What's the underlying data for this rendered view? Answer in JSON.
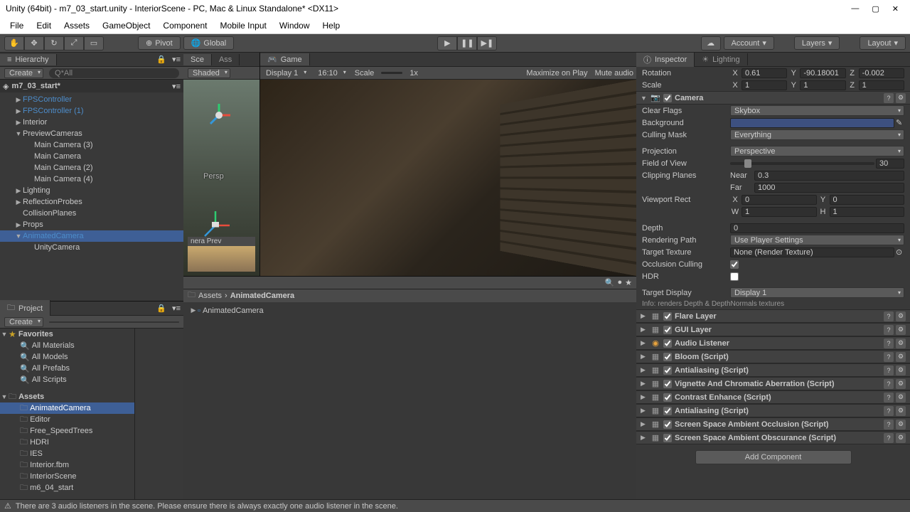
{
  "window": {
    "title": "Unity (64bit) - m7_03_start.unity - InteriorScene - PC, Mac & Linux Standalone* <DX11>"
  },
  "menu": [
    "File",
    "Edit",
    "Assets",
    "GameObject",
    "Component",
    "Mobile Input",
    "Window",
    "Help"
  ],
  "toolbar": {
    "pivot": "Pivot",
    "global": "Global",
    "account": "Account",
    "layers": "Layers",
    "layout": "Layout"
  },
  "hierarchy": {
    "title": "Hierarchy",
    "create": "Create",
    "search_ph": "Q*All",
    "scene": "m7_03_start*",
    "items": [
      {
        "label": "FPSController",
        "indent": 1,
        "prefab": true,
        "arrow": "▶"
      },
      {
        "label": "FPSController (1)",
        "indent": 1,
        "prefab": true,
        "arrow": "▶"
      },
      {
        "label": "Interior",
        "indent": 1,
        "arrow": "▶"
      },
      {
        "label": "PreviewCameras",
        "indent": 1,
        "arrow": "▼"
      },
      {
        "label": "Main Camera (3)",
        "indent": 2,
        "arrow": ""
      },
      {
        "label": "Main Camera",
        "indent": 2,
        "arrow": ""
      },
      {
        "label": "Main Camera (2)",
        "indent": 2,
        "arrow": ""
      },
      {
        "label": "Main Camera (4)",
        "indent": 2,
        "arrow": ""
      },
      {
        "label": "Lighting",
        "indent": 1,
        "arrow": "▶"
      },
      {
        "label": "ReflectionProbes",
        "indent": 1,
        "arrow": "▶"
      },
      {
        "label": "CollisionPlanes",
        "indent": 1,
        "arrow": ""
      },
      {
        "label": "Props",
        "indent": 1,
        "arrow": "▶"
      },
      {
        "label": "AnimatedCamera",
        "indent": 1,
        "prefab": true,
        "arrow": "▼",
        "sel": true
      },
      {
        "label": "UnityCamera",
        "indent": 2,
        "arrow": ""
      }
    ]
  },
  "scene": {
    "tab_scene": "Sce",
    "tab_asset": "Ass",
    "shaded": "Shaded",
    "persp": "Persp",
    "cam_prev": "nera Prev"
  },
  "game": {
    "title": "Game",
    "display": "Display 1",
    "aspect": "16:10",
    "scale": "Scale",
    "scale_val": "1x",
    "max": "Maximize on Play",
    "mute": "Mute audio"
  },
  "inspector": {
    "title": "Inspector",
    "lighting": "Lighting",
    "rotation": "Rotation",
    "rot_x": "0.61",
    "rot_y": "-90.18001",
    "rot_z": "-0.002",
    "scale": "Scale",
    "scl_x": "1",
    "scl_y": "1",
    "scl_z": "1",
    "camera": "Camera",
    "clear_flags": "Clear Flags",
    "clear_flags_v": "Skybox",
    "background": "Background",
    "culling": "Culling Mask",
    "culling_v": "Everything",
    "projection": "Projection",
    "projection_v": "Perspective",
    "fov": "Field of View",
    "fov_v": "30",
    "clip": "Clipping Planes",
    "near": "Near",
    "near_v": "0.3",
    "far": "Far",
    "far_v": "1000",
    "viewport": "Viewport Rect",
    "vr_x": "0",
    "vr_y": "0",
    "vr_w": "1",
    "vr_h": "1",
    "depth": "Depth",
    "depth_v": "0",
    "rendering": "Rendering Path",
    "rendering_v": "Use Player Settings",
    "target_tex": "Target Texture",
    "target_tex_v": "None (Render Texture)",
    "occlusion": "Occlusion Culling",
    "hdr": "HDR",
    "target_display": "Target Display",
    "target_display_v": "Display 1",
    "info": "Info: renders Depth & DepthNormals textures",
    "components": [
      {
        "name": "Flare Layer",
        "chk": true
      },
      {
        "name": "GUI Layer",
        "chk": true
      },
      {
        "name": "Audio Listener",
        "chk": true,
        "audio": true
      },
      {
        "name": "Bloom (Script)",
        "chk": true
      },
      {
        "name": "Antialiasing (Script)",
        "chk": true
      },
      {
        "name": "Vignette And Chromatic Aberration (Script)",
        "chk": true
      },
      {
        "name": "Contrast Enhance (Script)",
        "chk": true
      },
      {
        "name": "Antialiasing (Script)",
        "chk": true
      },
      {
        "name": "Screen Space Ambient Occlusion (Script)",
        "chk": true
      },
      {
        "name": "Screen Space Ambient Obscurance (Script)",
        "chk": true
      }
    ],
    "add_component": "Add Component"
  },
  "project": {
    "title": "Project",
    "create": "Create",
    "favorites": "Favorites",
    "fav_items": [
      "All Materials",
      "All Models",
      "All Prefabs",
      "All Scripts"
    ],
    "assets": "Assets",
    "folders": [
      "AnimatedCamera",
      "Editor",
      "Free_SpeedTrees",
      "HDRI",
      "IES",
      "Interior.fbm",
      "InteriorScene",
      "m6_04_start"
    ],
    "breadcrumb_1": "Assets",
    "breadcrumb_2": "AnimatedCamera",
    "file": "AnimatedCamera"
  },
  "status": "There are 3 audio listeners in the scene. Please ensure there is always exactly one audio listener in the scene."
}
